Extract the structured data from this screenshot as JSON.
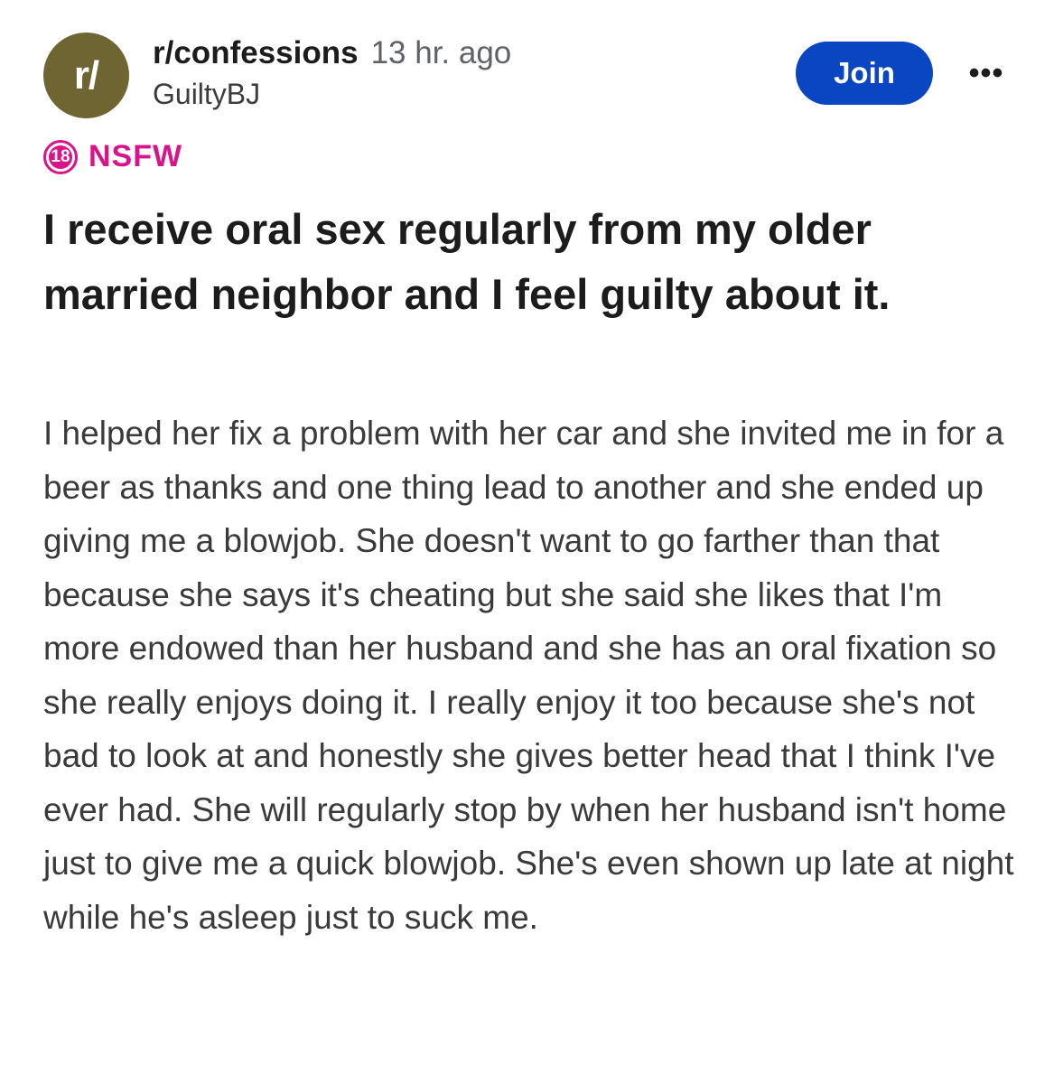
{
  "header": {
    "avatar_text": "r/",
    "subreddit": "r/confessions",
    "time": "13 hr. ago",
    "author": "GuiltyBJ",
    "join_label": "Join",
    "more_label": "•••"
  },
  "nsfw": {
    "badge_text": "18",
    "label": "NSFW",
    "color": "#d9148a"
  },
  "post": {
    "title": "I receive oral sex regularly from my older married neighbor and I feel guilty about it.",
    "body": "I helped her fix a problem with her car and she invited me in for a beer as thanks and one thing lead to another and she ended up giving me a blowjob. She doesn't want to go farther than that because she says it's cheating but she said she likes that I'm more endowed than her husband and she has an oral fixation so she really enjoys doing it. I really enjoy it too because she's not bad to look at and honestly she gives better head that I think I've ever had. She will regularly stop by when her husband isn't home just to give me a quick blowjob. She's even shown up late at night while he's asleep just to suck me."
  },
  "colors": {
    "accent": "#0a45c2",
    "avatar": "#6f6532"
  }
}
